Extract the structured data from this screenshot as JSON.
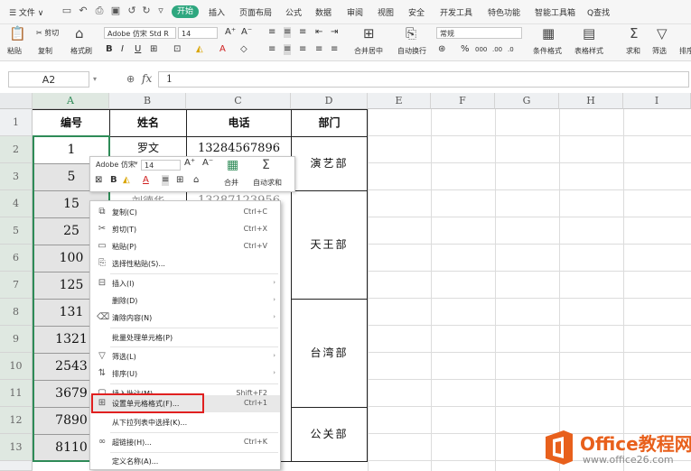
{
  "menubar": {
    "file": "☰ 文件 ∨",
    "start": "开始",
    "tabs": [
      "插入",
      "页面布局",
      "公式",
      "数据",
      "审阅",
      "视图",
      "安全",
      "开发工具",
      "特色功能",
      "智能工具箱"
    ],
    "search": "Q查找"
  },
  "ribbon": {
    "cut": "✂ 剪切",
    "copy": "复制",
    "paste": "粘贴",
    "format_painter": "格式刷",
    "font_name": "Adobe 仿宋 Std R",
    "font_size": "14",
    "merge_center": "合并居中",
    "auto_wrap": "自动换行",
    "number_format": "常规",
    "cond_format": "条件格式",
    "table_style": "表格样式",
    "sum": "求和",
    "filter": "筛选",
    "sort": "排序"
  },
  "formula_bar": {
    "name_box": "A2",
    "fx": "fx",
    "value": "1"
  },
  "grid": {
    "columns": [
      "A",
      "B",
      "C",
      "D",
      "E",
      "F",
      "G",
      "H",
      "I"
    ],
    "rows": [
      "1",
      "2",
      "3",
      "4",
      "5",
      "6",
      "7",
      "8",
      "9",
      "10",
      "11",
      "12",
      "13"
    ],
    "headers": {
      "a": "编号",
      "b": "姓名",
      "c": "电话",
      "d": "部门"
    },
    "col_a": [
      "1",
      "5",
      "15",
      "25",
      "100",
      "125",
      "131",
      "1321",
      "2543",
      "3679",
      "7890",
      "8110"
    ],
    "row2": {
      "name": "罗文",
      "phone": "13284567896"
    },
    "row4": {
      "name": "刘德华",
      "phone": "13287123956"
    },
    "depts": [
      "演艺部",
      "天王部",
      "台湾部",
      "公关部"
    ]
  },
  "mini_toolbar": {
    "font": "Adobe 仿宋",
    "size": "14",
    "merge": "合并",
    "autosum": "自动求和"
  },
  "context_menu": [
    {
      "label": "复制(C)",
      "shortcut": "Ctrl+C",
      "icon": "copy-icon"
    },
    {
      "label": "剪切(T)",
      "shortcut": "Ctrl+X",
      "icon": "scissors-icon"
    },
    {
      "label": "粘贴(P)",
      "shortcut": "Ctrl+V",
      "icon": "paste-icon"
    },
    {
      "label": "选择性粘贴(S)...",
      "shortcut": "",
      "icon": "paste-special-icon"
    },
    {
      "label": "插入(I)",
      "shortcut": "",
      "icon": "insert-icon"
    },
    {
      "label": "删除(D)",
      "shortcut": "",
      "icon": ""
    },
    {
      "label": "清除内容(N)",
      "shortcut": "",
      "icon": "eraser-icon"
    },
    {
      "label": "批量处理单元格(P)",
      "shortcut": "",
      "icon": ""
    },
    {
      "label": "筛选(L)",
      "shortcut": "",
      "icon": "filter-icon"
    },
    {
      "label": "排序(U)",
      "shortcut": "",
      "icon": "sort-icon"
    },
    {
      "label": "插入批注(M)...",
      "shortcut": "Shift+F2",
      "icon": "comment-icon"
    },
    {
      "label": "设置单元格格式(F)...",
      "shortcut": "Ctrl+1",
      "icon": "format-cells-icon"
    },
    {
      "label": "从下拉列表中选择(K)...",
      "shortcut": "",
      "icon": ""
    },
    {
      "label": "超链接(H)...",
      "shortcut": "Ctrl+K",
      "icon": "link-icon"
    },
    {
      "label": "定义名称(A)...",
      "shortcut": "",
      "icon": ""
    }
  ],
  "watermark": {
    "brand": "Office教程网",
    "url": "www.office26.com"
  },
  "colors": {
    "accent": "#2ea77f",
    "selection": "#2e8b57",
    "highlight": "#e02020",
    "logo_orange": "#e8601c"
  }
}
